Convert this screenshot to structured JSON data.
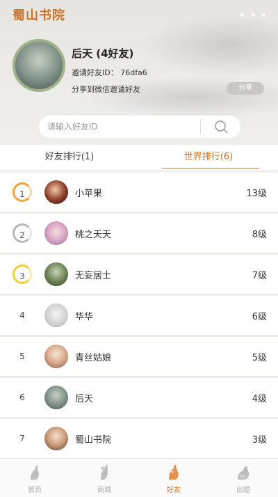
{
  "app": {
    "title": "蜀山书院"
  },
  "profile": {
    "name": "后天 (4好友)",
    "invite_id": "邀请好友ID： 76dfa6",
    "share_prompt": "分享到微信邀请好友",
    "share_button": "分享"
  },
  "search": {
    "placeholder": "请输入好友ID"
  },
  "tabs": [
    {
      "label": "好友排行(1)",
      "active": false
    },
    {
      "label": "世界排行(6)",
      "active": true
    }
  ],
  "ranking": [
    {
      "rank": "1",
      "name": "小苹果",
      "level": "13级"
    },
    {
      "rank": "2",
      "name": "桃之夭夭",
      "level": "8级"
    },
    {
      "rank": "3",
      "name": "无妄居士",
      "level": "7级"
    },
    {
      "rank": "4",
      "name": "华华",
      "level": "6级"
    },
    {
      "rank": "5",
      "name": "青丝姑娘",
      "level": "5级"
    },
    {
      "rank": "6",
      "name": "后天",
      "level": "4级"
    },
    {
      "rank": "7",
      "name": "蜀山书院",
      "level": "3级"
    }
  ],
  "nav": [
    {
      "label": "首页",
      "icon": "home-icon"
    },
    {
      "label": "商城",
      "icon": "shop-icon"
    },
    {
      "label": "好友",
      "icon": "friends-icon"
    },
    {
      "label": "出题",
      "icon": "quiz-icon"
    }
  ],
  "colors": {
    "accent": "#c8742a",
    "gold": "#f0a33a",
    "silver": "#b7b7b7",
    "bronze": "#f1cd35"
  }
}
